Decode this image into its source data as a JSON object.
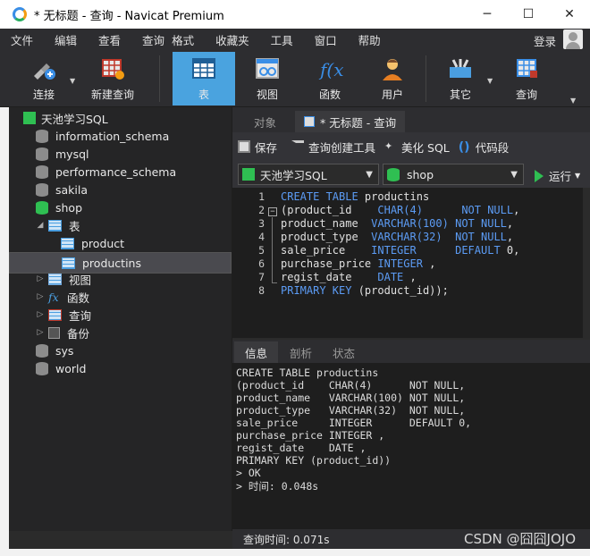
{
  "window": {
    "title": "* 无标题 - 查询 - Navicat Premium",
    "controls": [
      "minimize",
      "maximize",
      "close"
    ]
  },
  "menu": {
    "items": [
      "文件",
      "编辑",
      "查看",
      "查询",
      "格式",
      "收藏夹",
      "工具",
      "窗口",
      "帮助"
    ],
    "login": "登录"
  },
  "toolbar": {
    "buttons": [
      {
        "label": "连接",
        "icon": "connection-icon"
      },
      {
        "label": "新建查询",
        "icon": "new-query-icon"
      },
      {
        "label": "表",
        "icon": "table-icon",
        "active": true
      },
      {
        "label": "视图",
        "icon": "view-icon"
      },
      {
        "label": "函数",
        "icon": "function-icon"
      },
      {
        "label": "用户",
        "icon": "user-icon"
      },
      {
        "label": "其它",
        "icon": "tools-icon"
      },
      {
        "label": "查询",
        "icon": "query-icon"
      }
    ]
  },
  "tree": {
    "connection": "天池学习SQL",
    "databases": [
      "information_schema",
      "mysql",
      "performance_schema",
      "sakila",
      "shop",
      "sys",
      "world"
    ],
    "shop_children": {
      "tables_label": "表",
      "tables": [
        "product",
        "productins"
      ],
      "views_label": "视图",
      "functions_label": "函数",
      "queries_label": "查询",
      "backups_label": "备份"
    },
    "selected": "productins"
  },
  "tabs": {
    "objects": "对象",
    "query": "* 无标题 - 查询"
  },
  "query_toolbar": {
    "save": "保存",
    "builder": "查询创建工具",
    "beautify": "美化 SQL",
    "snippet": "代码段",
    "connection_select": "天池学习SQL",
    "database_select": "shop",
    "run": "运行"
  },
  "editor": {
    "lines": [
      {
        "n": "1",
        "t": [
          [
            "kw",
            "CREATE TABLE "
          ],
          [
            "nm",
            "productins"
          ]
        ]
      },
      {
        "n": "2",
        "t": [
          [
            "nm",
            "(product_id    "
          ],
          [
            "ty",
            "CHAR(4)"
          ],
          [
            "nm",
            "      "
          ],
          [
            "kw",
            "NOT NULL"
          ],
          [
            "nm",
            ","
          ]
        ]
      },
      {
        "n": "3",
        "t": [
          [
            "nm",
            "product_name  "
          ],
          [
            "ty",
            "VARCHAR(100)"
          ],
          [
            "nm",
            " "
          ],
          [
            "kw",
            "NOT NULL"
          ],
          [
            "nm",
            ","
          ]
        ]
      },
      {
        "n": "4",
        "t": [
          [
            "nm",
            "product_type  "
          ],
          [
            "ty",
            "VARCHAR(32)"
          ],
          [
            "nm",
            "  "
          ],
          [
            "kw",
            "NOT NULL"
          ],
          [
            "nm",
            ","
          ]
        ]
      },
      {
        "n": "5",
        "t": [
          [
            "nm",
            "sale_price    "
          ],
          [
            "ty",
            "INTEGER"
          ],
          [
            "nm",
            "      "
          ],
          [
            "kw",
            "DEFAULT "
          ],
          [
            "nm",
            "0,"
          ]
        ]
      },
      {
        "n": "6",
        "t": [
          [
            "nm",
            "purchase_price "
          ],
          [
            "ty",
            "INTEGER"
          ],
          [
            "nm",
            " ,"
          ]
        ]
      },
      {
        "n": "7",
        "t": [
          [
            "nm",
            "regist_date    "
          ],
          [
            "ty",
            "DATE"
          ],
          [
            "nm",
            " ,"
          ]
        ]
      },
      {
        "n": "8",
        "t": [
          [
            "kw",
            "PRIMARY KEY "
          ],
          [
            "nm",
            "(product_id));"
          ]
        ]
      }
    ]
  },
  "bottom_tabs": [
    "信息",
    "剖析",
    "状态"
  ],
  "output": {
    "lines": [
      "CREATE TABLE productins",
      "(product_id    CHAR(4)      NOT NULL,",
      "product_name   VARCHAR(100) NOT NULL,",
      "product_type   VARCHAR(32)  NOT NULL,",
      "sale_price     INTEGER      DEFAULT 0,",
      "purchase_price INTEGER ,",
      "regist_date    DATE ,",
      "PRIMARY KEY (product_id))",
      "> OK",
      "> 时间: 0.048s"
    ]
  },
  "status": {
    "query_time": "查询时间: 0.071s",
    "watermark": "CSDN @囧囧JOJO"
  },
  "colors": {
    "accent": "#4aa3df",
    "keyword": "#5c9cf5",
    "db_active": "#2fbf52",
    "background": "#1e1e1e"
  }
}
